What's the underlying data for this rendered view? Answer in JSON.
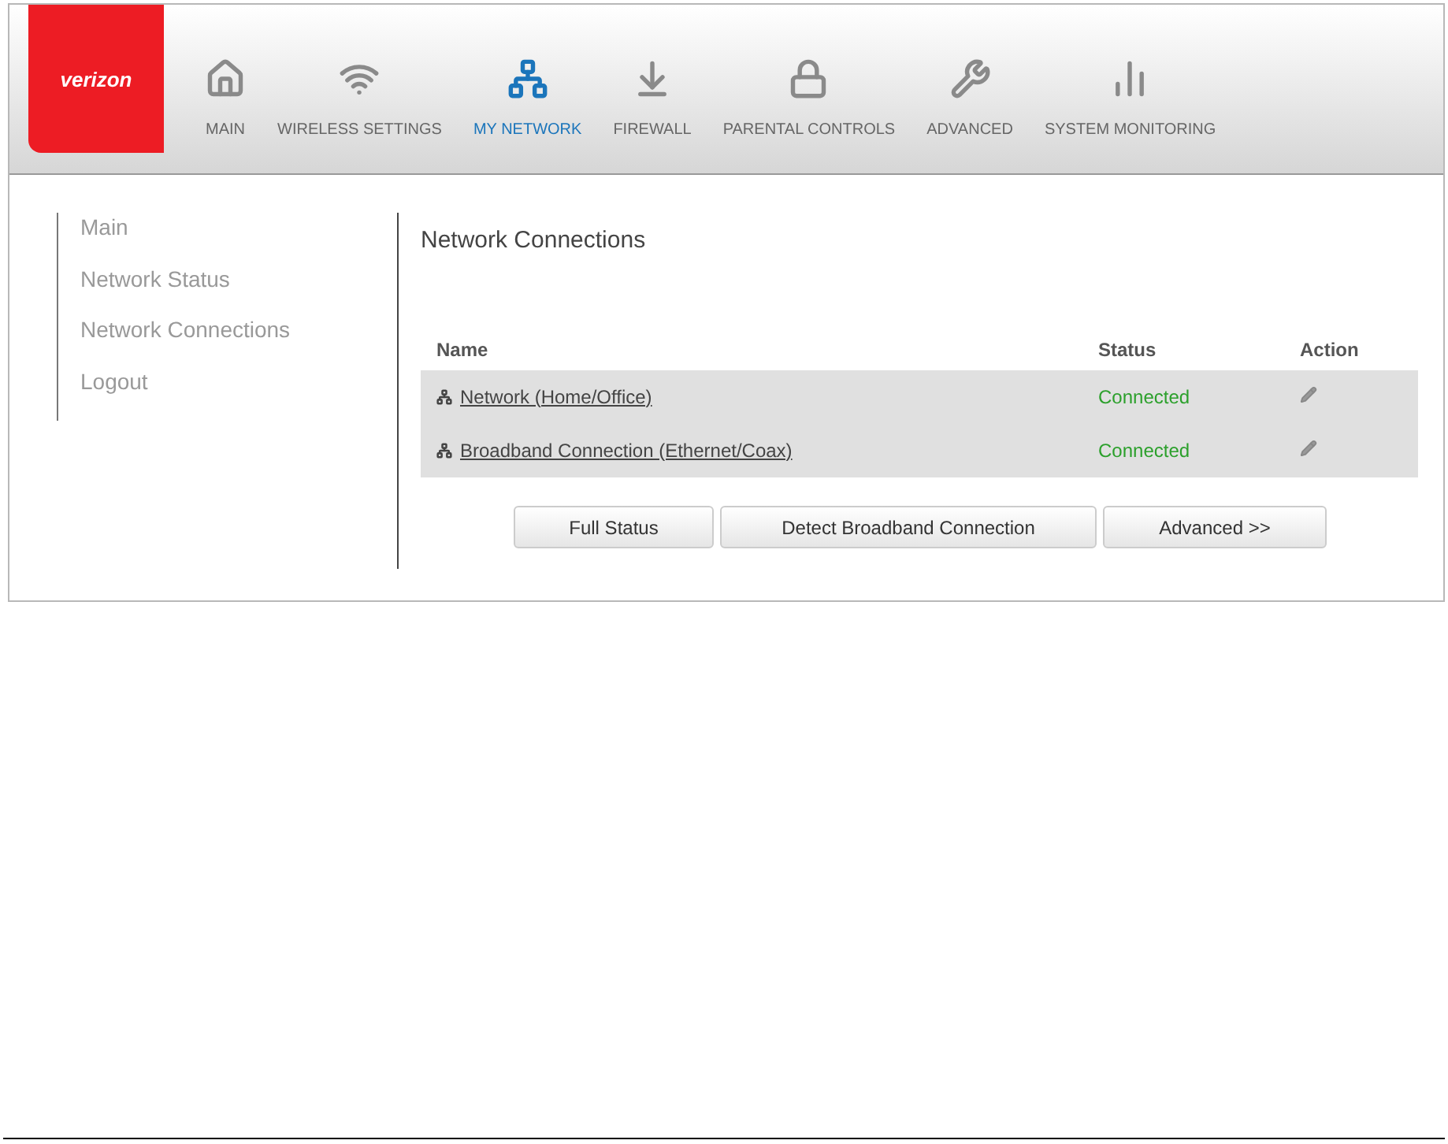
{
  "logo": {
    "text": "verizon"
  },
  "nav": [
    {
      "label": "MAIN",
      "selected": false
    },
    {
      "label": "WIRELESS SETTINGS",
      "selected": false
    },
    {
      "label": "MY NETWORK",
      "selected": true
    },
    {
      "label": "FIREWALL",
      "selected": false
    },
    {
      "label": "PARENTAL CONTROLS",
      "selected": false
    },
    {
      "label": "ADVANCED",
      "selected": false
    },
    {
      "label": "SYSTEM MONITORING",
      "selected": false
    }
  ],
  "sidebar": {
    "items": [
      "Main",
      "Network Status",
      "Network Connections",
      "Logout"
    ]
  },
  "content": {
    "title": "Network Connections",
    "table": {
      "columns": [
        "Name",
        "Status",
        "Action"
      ],
      "rows": [
        {
          "name": "Network (Home/Office)",
          "status": "Connected"
        },
        {
          "name": "Broadband Connection (Ethernet/Coax)",
          "status": "Connected"
        }
      ]
    },
    "buttons": [
      "Full Status",
      "Detect Broadband Connection",
      "Advanced >>"
    ]
  }
}
